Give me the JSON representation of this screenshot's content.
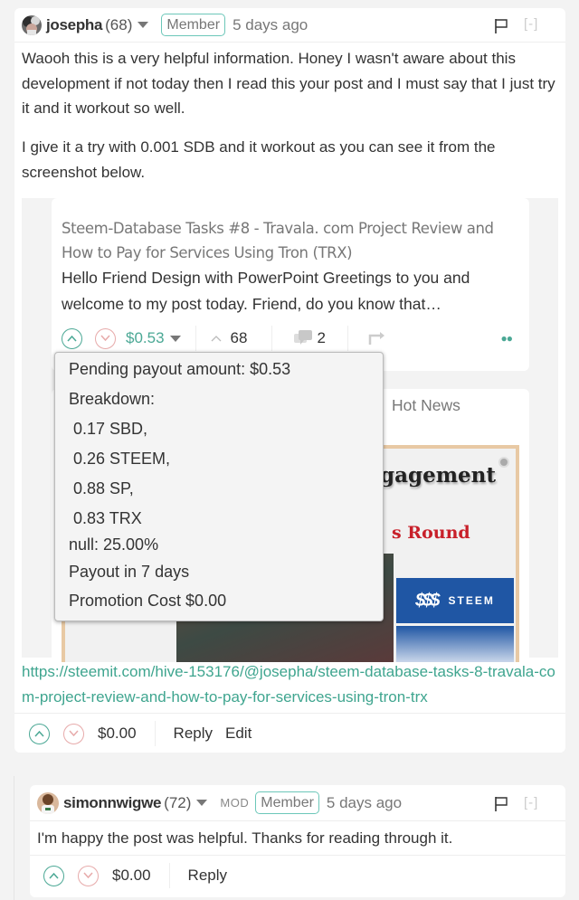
{
  "comment": {
    "author": "josepha",
    "reputation": "(68)",
    "badge": "Member",
    "time": "5 days ago",
    "collapse_label": "[-]",
    "paragraphs": [
      "Waooh this is a very helpful information. Honey I wasn't aware about this development if not today then I read this your post and I must say that I just try it and it workout so well.",
      "I give it a try with 0.001 SDB and it workout as you can see it from the screenshot below."
    ],
    "link": "https://steemit.com/hive-153176/@josepha/steem-database-tasks-8-travala-com-project-review-and-how-to-pay-for-services-using-tron-trx",
    "footer": {
      "payout": "$0.00",
      "reply_label": "Reply",
      "edit_label": "Edit"
    }
  },
  "embedded_screenshot": {
    "post_title": "Steem-Database Tasks #8 - Travala. com Project Review and How to Pay for Services Using Tron (TRX)",
    "post_excerpt": "Hello Friend Design with PowerPoint Greetings to you and welcome to my post today. Friend, do you know that…",
    "payout": "$0.53",
    "votes": "68",
    "comments": "2",
    "second_post_title_fragment": "Hot News",
    "image_text": {
      "line1": "gagement",
      "line2": "s Round",
      "brand": "STEEM"
    },
    "tooltip": {
      "pending": "Pending payout amount: $0.53",
      "breakdown_label": "Breakdown:",
      "breakdown": [
        "0.17 SBD,",
        "0.26 STEEM,",
        "0.88 SP,",
        "0.83 TRX"
      ],
      "null_line": "null: 25.00%",
      "payout_in": "Payout in 7 days",
      "promotion": "Promotion Cost $0.00"
    }
  },
  "reply": {
    "author": "simonnwigwe",
    "reputation": "(72)",
    "role": "MOD",
    "badge": "Member",
    "time": "5 days ago",
    "collapse_label": "[-]",
    "text": "I'm happy the post was helpful. Thanks for reading through it.",
    "footer": {
      "payout": "$0.00",
      "reply_label": "Reply"
    }
  },
  "colors": {
    "upvote": "#4ba895",
    "downvote": "#e7aaaa",
    "link": "#3fa58f",
    "badge_border": "#6cc7b9"
  }
}
